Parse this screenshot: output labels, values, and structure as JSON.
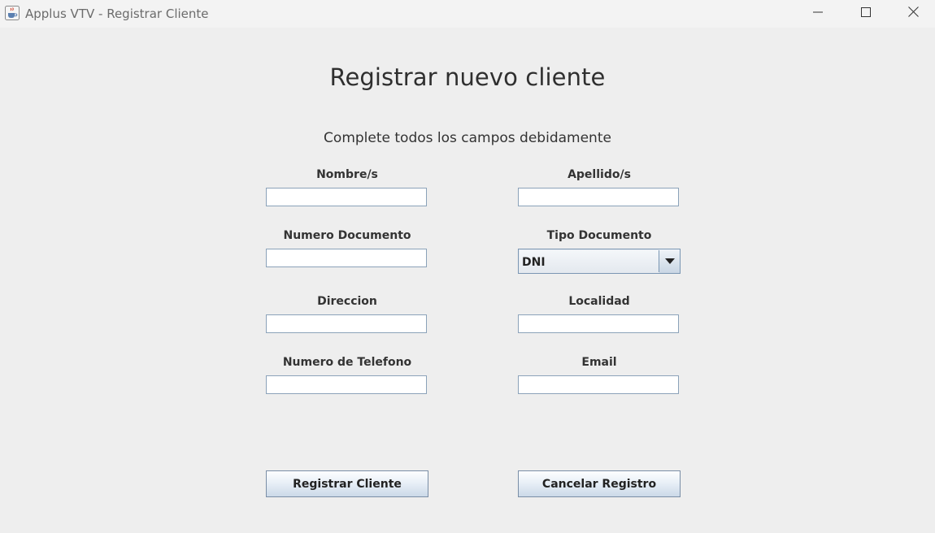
{
  "window": {
    "title": "Applus VTV - Registrar Cliente",
    "controls": {
      "minimize_icon": "minimize-icon",
      "maximize_icon": "maximize-icon",
      "close_icon": "close-icon"
    },
    "app_icon": "java-coffee-icon"
  },
  "form": {
    "title": "Registrar nuevo cliente",
    "subtitle": "Complete todos los campos debidamente",
    "fields": {
      "nombre": {
        "label": "Nombre/s",
        "value": ""
      },
      "apellido": {
        "label": "Apellido/s",
        "value": ""
      },
      "numero_documento": {
        "label": "Numero Documento",
        "value": ""
      },
      "tipo_documento": {
        "label": "Tipo Documento",
        "selected": "DNI"
      },
      "direccion": {
        "label": "Direccion",
        "value": ""
      },
      "localidad": {
        "label": "Localidad",
        "value": ""
      },
      "telefono": {
        "label": "Numero de Telefono",
        "value": ""
      },
      "email": {
        "label": "Email",
        "value": ""
      }
    },
    "buttons": {
      "register": "Registrar Cliente",
      "cancel": "Cancelar Registro"
    }
  },
  "colors": {
    "background": "#eeeeee",
    "field_border": "#8ba2b9",
    "button_gradient_bottom": "#cbd9e8"
  }
}
